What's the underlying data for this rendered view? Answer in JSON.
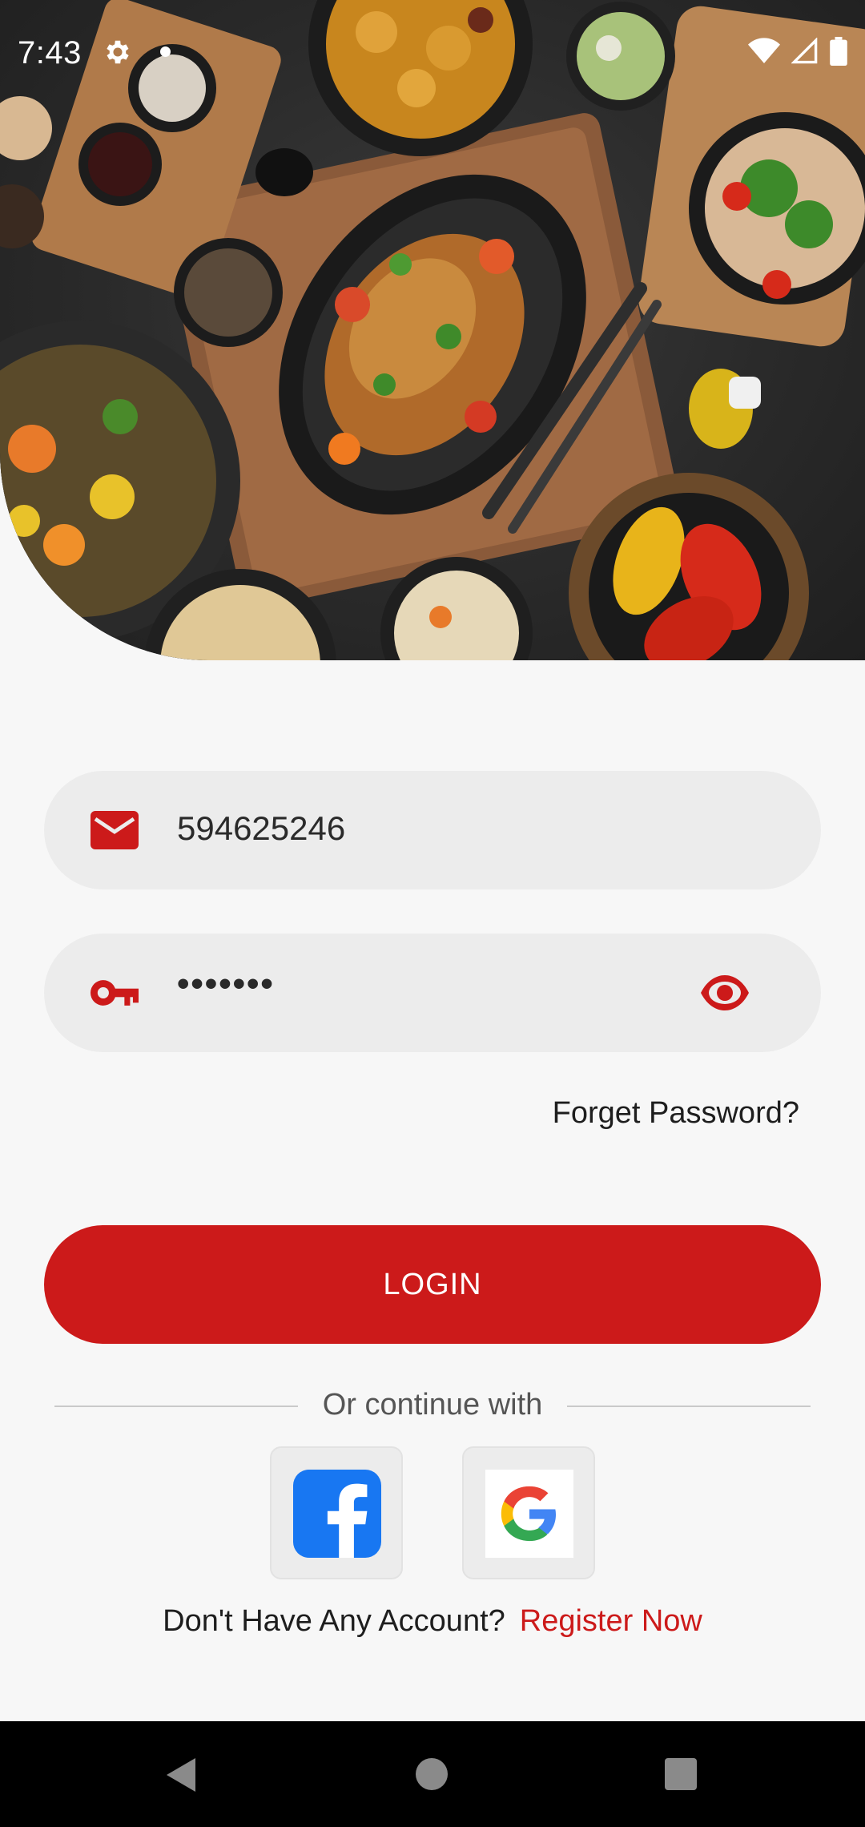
{
  "status_bar": {
    "time": "7:43"
  },
  "hero": {
    "image": "food-spread-photo"
  },
  "login_form": {
    "email_value": "594625246",
    "password_value": "•••••••",
    "forgot_label": "Forget Password?",
    "login_label": "LOGIN"
  },
  "social": {
    "divider_text": "Or continue with",
    "providers": [
      "facebook",
      "google"
    ]
  },
  "register": {
    "question": "Don't Have Any Account?",
    "link": "Register Now"
  },
  "colors": {
    "accent": "#cc1a1a",
    "field_bg": "#ececec",
    "page_bg": "#f7f7f7",
    "facebook": "#1877f2"
  },
  "icons": {
    "email": "envelope-icon",
    "password": "key-icon",
    "visibility": "eye-icon",
    "settings": "gear-icon",
    "wifi": "wifi-icon",
    "signal": "signal-icon",
    "battery": "battery-icon"
  }
}
